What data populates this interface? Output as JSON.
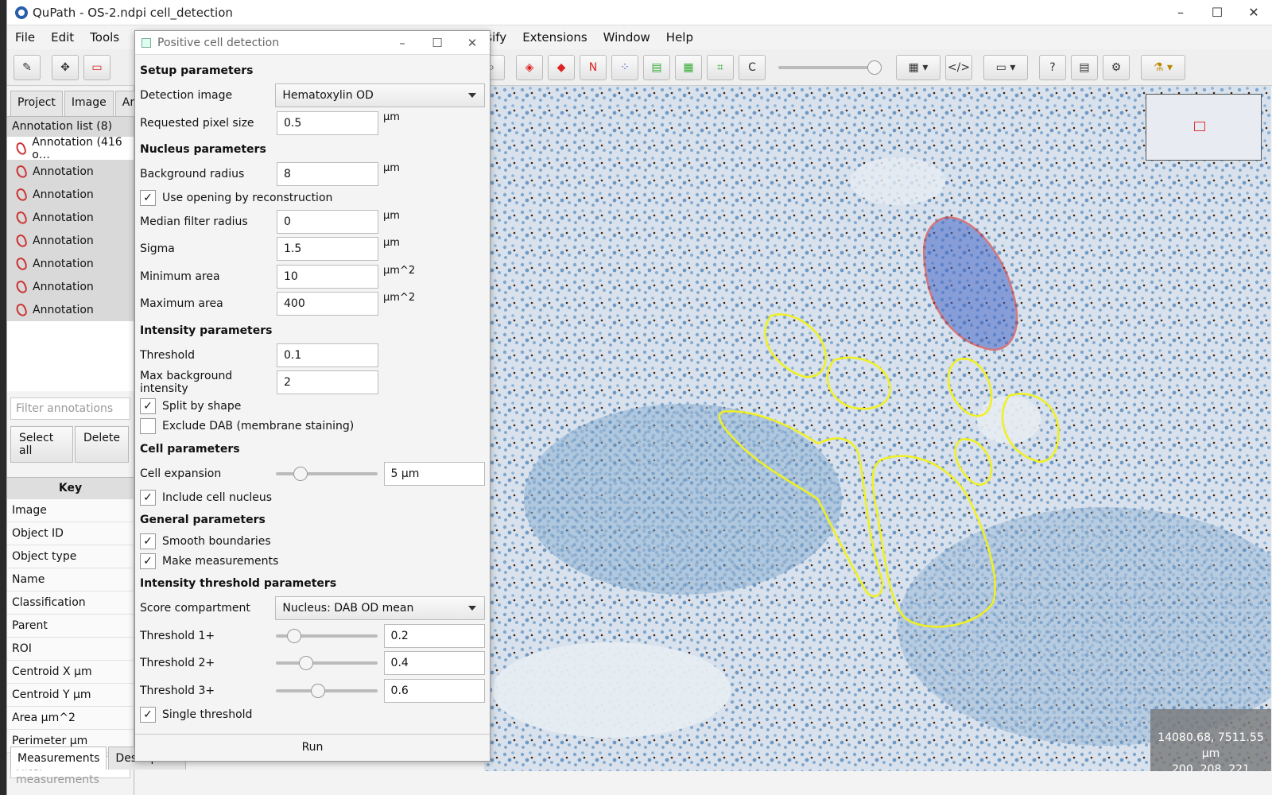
{
  "window": {
    "title": "QuPath - OS-2.ndpi cell_detection"
  },
  "menu": [
    "File",
    "Edit",
    "Tools",
    "lassify",
    "Extensions",
    "Window",
    "Help"
  ],
  "toolbar": {
    "n_label": "N",
    "c_label": "C"
  },
  "left": {
    "tabs": [
      "Project",
      "Image",
      "An"
    ],
    "list_header": "Annotation list (8)",
    "annotations": [
      "Annotation (416 o…",
      "Annotation",
      "Annotation",
      "Annotation",
      "Annotation",
      "Annotation",
      "Annotation",
      "Annotation"
    ],
    "filter_placeholder": "Filter annotations",
    "select_all": "Select all",
    "delete": "Delete",
    "key_header": "Key",
    "keys": [
      "Image",
      "Object ID",
      "Object type",
      "Name",
      "Classification",
      "Parent",
      "ROI",
      "Centroid X µm",
      "Centroid Y µm",
      "Area µm^2",
      "Perimeter µm"
    ],
    "filter_measurements": "Filter measurements",
    "bottom_tabs": [
      "Measurements",
      "Description"
    ]
  },
  "dialog": {
    "title": "Positive cell detection",
    "setup": "Setup parameters",
    "detection_image_label": "Detection image",
    "detection_image": "Hematoxylin OD",
    "pixel_size_label": "Requested pixel size",
    "pixel_size": "0.5",
    "unit_um": "µm",
    "unit_um2": "µm^2",
    "nucleus": "Nucleus parameters",
    "bg_radius_label": "Background radius",
    "bg_radius": "8",
    "opening_label": "Use opening by reconstruction",
    "median_label": "Median filter radius",
    "median": "0",
    "sigma_label": "Sigma",
    "sigma": "1.5",
    "min_area_label": "Minimum area",
    "min_area": "10",
    "max_area_label": "Maximum area",
    "max_area": "400",
    "intensity": "Intensity parameters",
    "threshold_label": "Threshold",
    "threshold": "0.1",
    "max_bg_label": "Max background intensity",
    "max_bg": "2",
    "split_label": "Split by shape",
    "exclude_label": "Exclude DAB (membrane staining)",
    "cell": "Cell parameters",
    "expansion_label": "Cell expansion",
    "expansion": "5 µm",
    "expansion_level": 0.2,
    "include_label": "Include cell nucleus",
    "general": "General parameters",
    "smooth_label": "Smooth boundaries",
    "measure_label": "Make measurements",
    "intensity_threshold": "Intensity threshold parameters",
    "score_label": "Score compartment",
    "score": "Nucleus: DAB OD mean",
    "t1_label": "Threshold 1+",
    "t1": "0.2",
    "t1_level": 0.13,
    "t2_label": "Threshold 2+",
    "t2": "0.4",
    "t2_level": 0.26,
    "t3_label": "Threshold 3+",
    "t3": "0.6",
    "t3_level": 0.4,
    "single_label": "Single threshold",
    "run": "Run",
    "check": "✓"
  },
  "viewer": {
    "coords_line1": "14080.68, 7511.55 µm",
    "coords_line2": "200, 208, 221"
  },
  "colors": {
    "annotation_red": "#d32020",
    "annotation_yellow": "#f0f020",
    "tissue_bg": "#dfe6ee"
  }
}
